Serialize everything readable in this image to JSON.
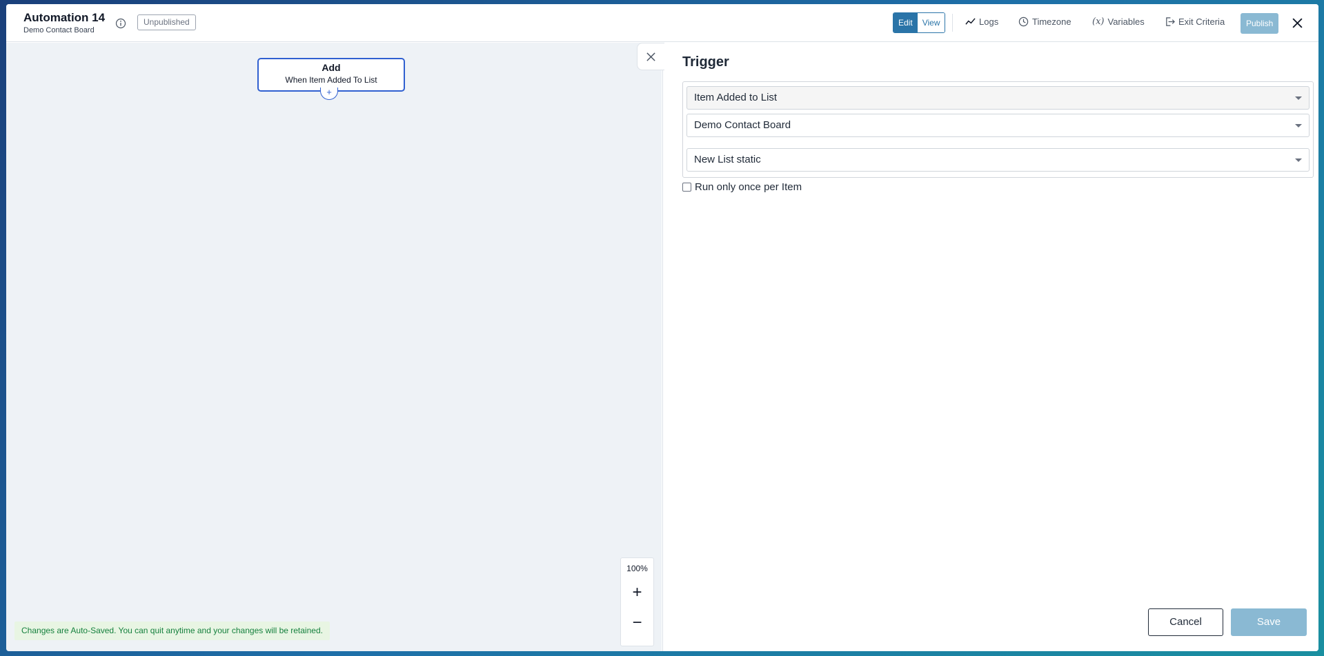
{
  "header": {
    "title": "Automation 14",
    "subtitle": "Demo Contact Board",
    "status": "Unpublished",
    "mode_edit": "Edit",
    "mode_view": "View",
    "links": {
      "logs": "Logs",
      "timezone": "Timezone",
      "variables": "Variables",
      "exit_criteria": "Exit Criteria"
    },
    "publish": "Publish"
  },
  "canvas": {
    "node": {
      "title": "Add",
      "subtitle": "When Item Added To List",
      "add_symbol": "+"
    },
    "zoom": {
      "level": "100%",
      "in": "+",
      "out": "−"
    },
    "autosave_notice": "Changes are Auto-Saved. You can quit anytime and your changes will be retained."
  },
  "panel": {
    "title": "Trigger",
    "trigger_type": "Item Added to List",
    "board": "Demo Contact Board",
    "list": "New List static",
    "run_once_label": "Run only once per Item",
    "cancel": "Cancel",
    "save": "Save"
  },
  "colors": {
    "accent": "#2a74a8",
    "publish_disabled": "#8ab9d3",
    "node_border": "#2f5fd0",
    "autosave_bg": "#e8f5e3",
    "autosave_text": "#15803d"
  }
}
